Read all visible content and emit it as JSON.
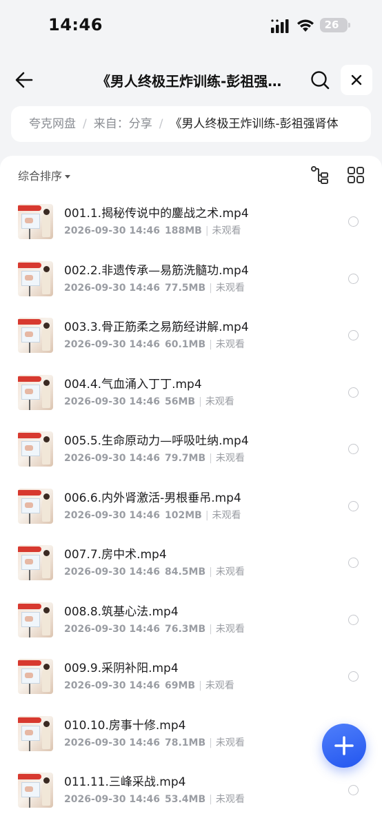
{
  "status_bar": {
    "time": "14:46",
    "battery": "26"
  },
  "nav": {
    "title": "《男人终极王炸训练-彭祖强…",
    "back_icon": "arrow-left-icon",
    "search_icon": "search-icon",
    "close_icon": "close-icon"
  },
  "breadcrumb": {
    "items": [
      "夸克网盘",
      "来自：分享"
    ],
    "current": "《男人终极王炸训练-彭祖强肾体"
  },
  "toolbar": {
    "sort_label": "综合排序",
    "tree_icon": "tree-structure-icon",
    "grid_icon": "grid-view-icon"
  },
  "files": [
    {
      "name": "001.1.揭秘传说中的鏖战之术.mp4",
      "date": "2026-09-30 14:46",
      "size": "188MB",
      "watch": "未观看"
    },
    {
      "name": "002.2.非遗传承—易筋洗髓功.mp4",
      "date": "2026-09-30 14:46",
      "size": "77.5MB",
      "watch": "未观看"
    },
    {
      "name": "003.3.骨正筋柔之易筋经讲解.mp4",
      "date": "2026-09-30 14:46",
      "size": "60.1MB",
      "watch": "未观看"
    },
    {
      "name": "004.4.气血涌入丁丁.mp4",
      "date": "2026-09-30 14:46",
      "size": "56MB",
      "watch": "未观看"
    },
    {
      "name": "005.5.生命原动力—呼吸吐纳.mp4",
      "date": "2026-09-30 14:46",
      "size": "79.7MB",
      "watch": "未观看"
    },
    {
      "name": "006.6.内外肾激活-男根垂吊.mp4",
      "date": "2026-09-30 14:46",
      "size": "102MB",
      "watch": "未观看"
    },
    {
      "name": "007.7.房中术.mp4",
      "date": "2026-09-30 14:46",
      "size": "84.5MB",
      "watch": "未观看"
    },
    {
      "name": "008.8.筑基心法.mp4",
      "date": "2026-09-30 14:46",
      "size": "76.3MB",
      "watch": "未观看"
    },
    {
      "name": "009.9.采阴补阳.mp4",
      "date": "2026-09-30 14:46",
      "size": "69MB",
      "watch": "未观看"
    },
    {
      "name": "010.10.房事十修.mp4",
      "date": "2026-09-30 14:46",
      "size": "78.1MB",
      "watch": "未观看"
    },
    {
      "name": "011.11.三峰采战.mp4",
      "date": "2026-09-30 14:46",
      "size": "53.4MB",
      "watch": "未观看"
    }
  ],
  "fab": {
    "icon": "plus-icon"
  },
  "colors": {
    "accent": "#2f62f2",
    "background": "#f3f4f6"
  }
}
